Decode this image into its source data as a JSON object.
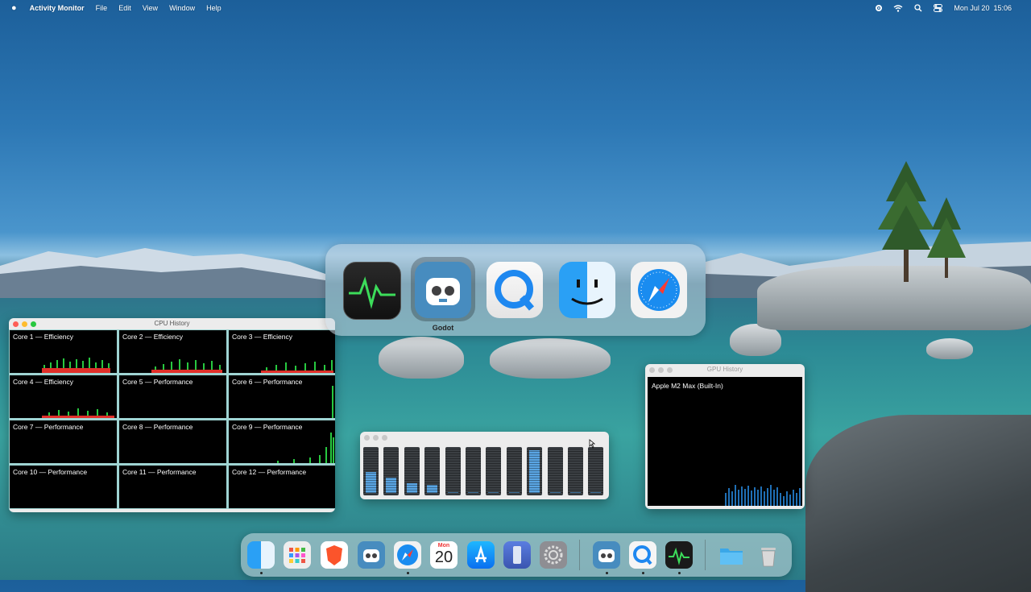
{
  "menubar": {
    "app_name": "Activity Monitor",
    "menus": [
      "File",
      "Edit",
      "View",
      "Window",
      "Help"
    ],
    "date": "Mon Jul 20",
    "time": "15:06"
  },
  "cpu_window": {
    "title": "CPU History",
    "cores": [
      {
        "label": "Core 1 — Efficiency"
      },
      {
        "label": "Core 2 — Efficiency"
      },
      {
        "label": "Core 3 — Efficiency"
      },
      {
        "label": "Core 4 — Efficiency"
      },
      {
        "label": "Core 5 — Performance"
      },
      {
        "label": "Core 6 — Performance"
      },
      {
        "label": "Core 7 — Performance"
      },
      {
        "label": "Core 8 — Performance"
      },
      {
        "label": "Core 9 — Performance"
      },
      {
        "label": "Core 10 — Performance"
      },
      {
        "label": "Core 11 — Performance"
      },
      {
        "label": "Core 12 — Performance"
      }
    ]
  },
  "gpu_window": {
    "title": "GPU History",
    "gpu_name": "Apple M2 Max (Built-In)"
  },
  "cpu_meter_window": {
    "levels": [
      0.48,
      0.35,
      0.22,
      0.18,
      0.02,
      0.02,
      0.02,
      0.02,
      0.98,
      0.02,
      0.02,
      0.02
    ]
  },
  "app_switcher": {
    "apps": [
      "Activity Monitor",
      "Godot",
      "QuickTime Player",
      "Finder",
      "Safari"
    ],
    "selected_label": "Godot"
  },
  "dock": {
    "calendar_month": "Mon",
    "calendar_day": "20",
    "apps": [
      "Finder",
      "Launchpad",
      "Brave Browser",
      "Godot",
      "Safari",
      "Calendar",
      "App Store",
      "Simulator",
      "System Settings",
      "Godot",
      "QuickTime Player",
      "Activity Monitor",
      "Downloads",
      "Trash"
    ]
  },
  "colors": {
    "system_bar": "#28c840",
    "user_bar": "#e0302a",
    "gpu_bar": "#1f6fb5",
    "meter_fill": "#5aa5e3"
  }
}
